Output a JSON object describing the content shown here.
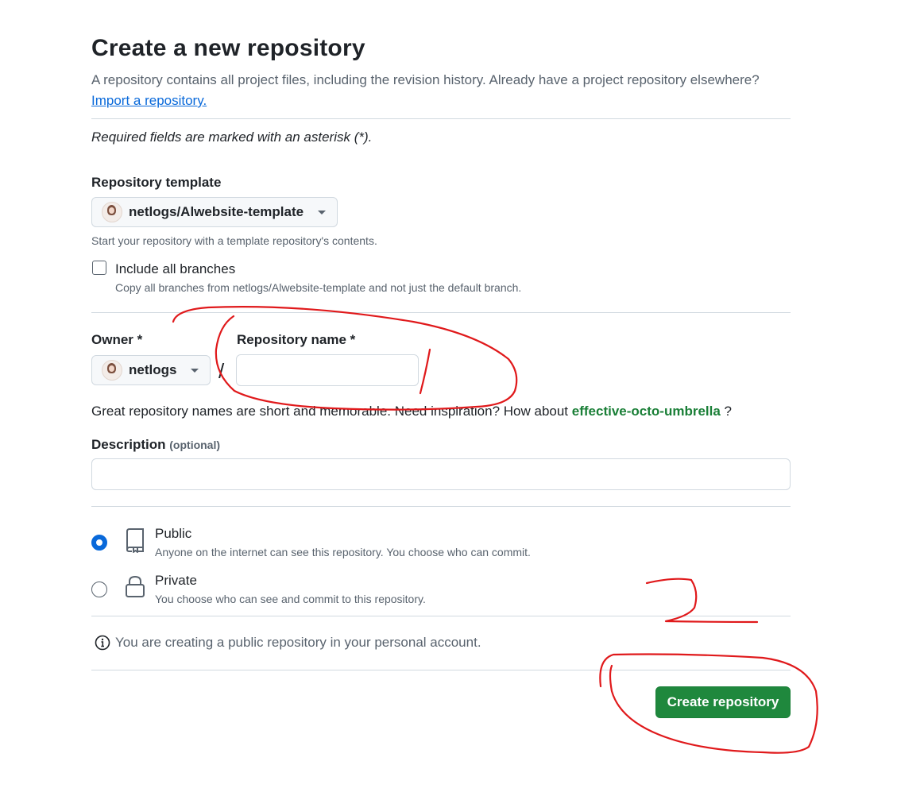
{
  "header": {
    "title": "Create a new repository",
    "description": "A repository contains all project files, including the revision history. Already have a project repository elsewhere?",
    "import_link": "Import a repository."
  },
  "required_note": "Required fields are marked with an asterisk (*).",
  "template": {
    "label": "Repository template",
    "selected": "netlogs/Alwebsite-template",
    "hint": "Start your repository with a template repository's contents.",
    "include_branches_label": "Include all branches",
    "include_branches_hint": "Copy all branches from netlogs/Alwebsite-template and not just the default branch.",
    "include_branches_checked": false
  },
  "owner": {
    "label": "Owner *",
    "selected": "netlogs"
  },
  "separator": "/",
  "repo_name": {
    "label": "Repository name *",
    "value": ""
  },
  "name_hint": {
    "text": "Great repository names are short and memorable. Need inspiration? How about",
    "suggestion": "effective-octo-umbrella",
    "suffix": "?"
  },
  "description_field": {
    "label": "Description",
    "optional": "(optional)",
    "value": ""
  },
  "visibility": {
    "options": [
      {
        "label": "Public",
        "hint": "Anyone on the internet can see this repository. You choose who can commit.",
        "icon": "repo-icon",
        "selected": true
      },
      {
        "label": "Private",
        "hint": "You choose who can see and commit to this repository.",
        "icon": "lock-icon",
        "selected": false
      }
    ]
  },
  "info_text": "You are creating a public repository in your personal account.",
  "submit_label": "Create repository",
  "colors": {
    "primary_button": "#1f883d",
    "link": "#0969da",
    "suggestion": "#1a7f37",
    "annotation": "#e0191b"
  }
}
